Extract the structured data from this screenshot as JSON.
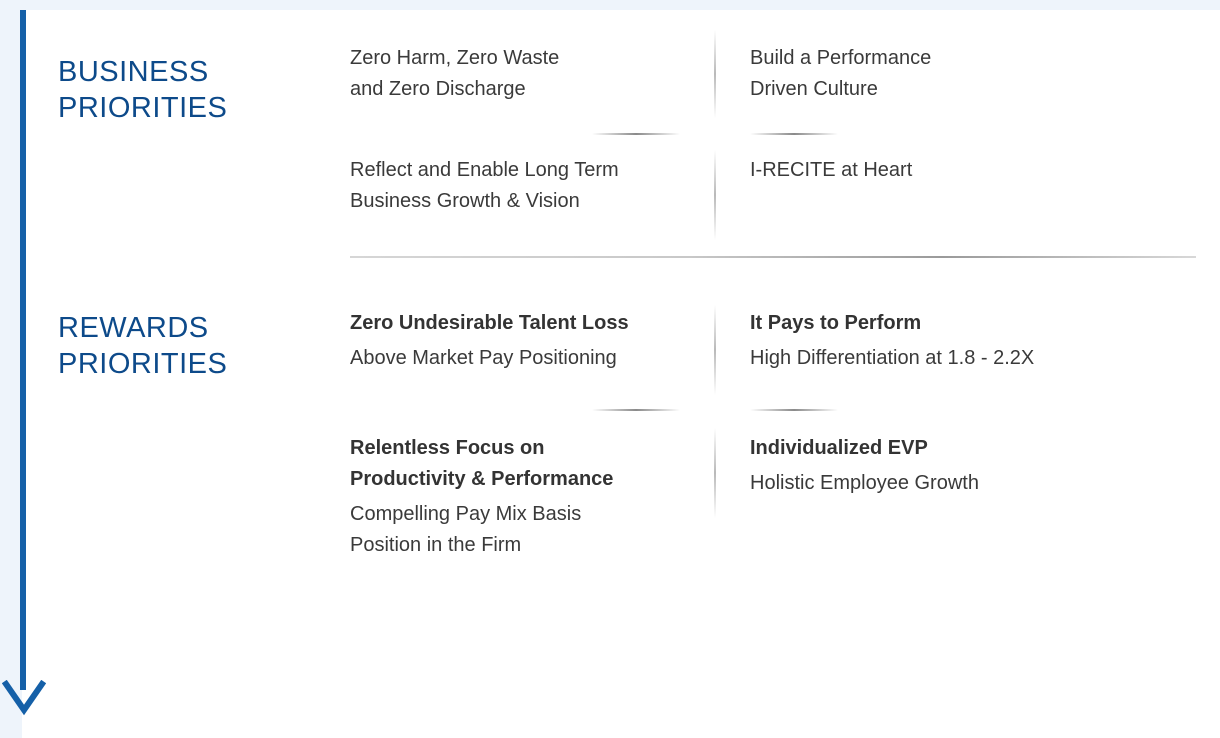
{
  "business": {
    "title_line1": "BUSINESS",
    "title_line2": "PRIORITIES",
    "items": [
      {
        "line1": "Zero Harm, Zero Waste",
        "line2": "and Zero Discharge"
      },
      {
        "line1": "Build a Performance",
        "line2": "Driven Culture"
      },
      {
        "line1": "Reflect and Enable Long Term",
        "line2": "Business Growth & Vision"
      },
      {
        "line1": "I-RECITE at Heart",
        "line2": ""
      }
    ]
  },
  "rewards": {
    "title_line1": "REWARDS",
    "title_line2": "PRIORITIES",
    "items": [
      {
        "heading1": "Zero Undesirable Talent Loss",
        "heading2": "",
        "text1": "Above Market Pay Positioning",
        "text2": ""
      },
      {
        "heading1": "It Pays to Perform",
        "heading2": "",
        "text1": "High Differentiation at 1.8 - 2.2X",
        "text2": ""
      },
      {
        "heading1": "Relentless Focus on",
        "heading2": "Productivity & Performance",
        "text1": "Compelling Pay Mix Basis",
        "text2": "Position in the Firm"
      },
      {
        "heading1": "Individualized EVP",
        "heading2": "",
        "text1": "Holistic Employee Growth",
        "text2": ""
      }
    ]
  },
  "colors": {
    "accent": "#1560a8",
    "title": "#0d4a8a",
    "background": "#eef4fb"
  },
  "icons": {
    "timeline_arrow": "arrow-down-icon"
  }
}
